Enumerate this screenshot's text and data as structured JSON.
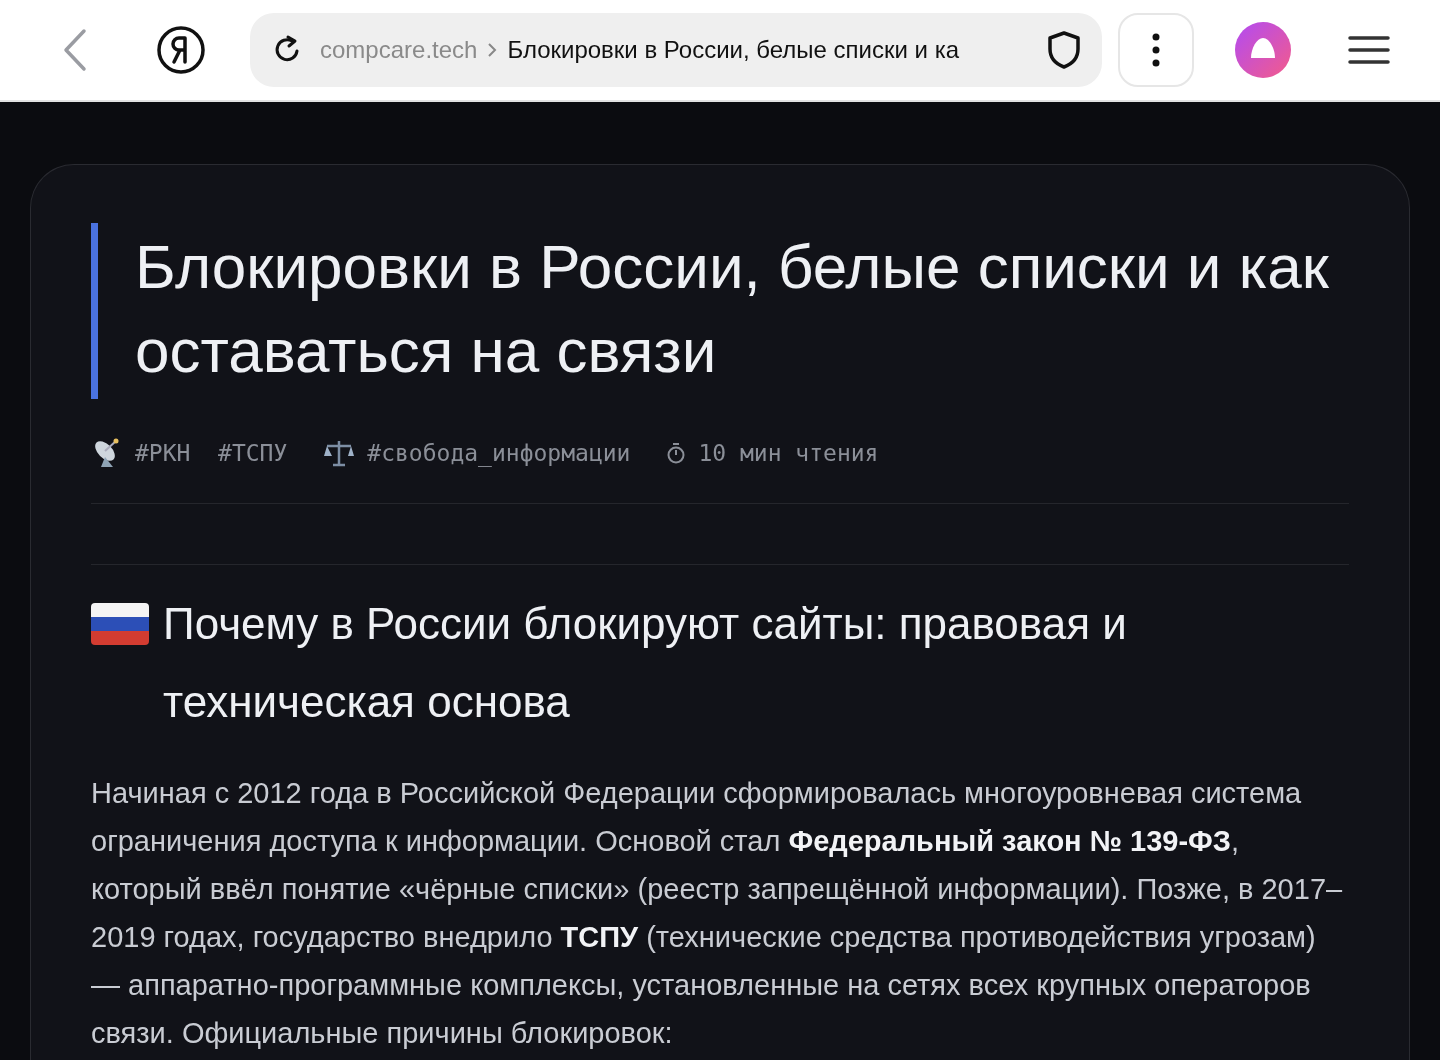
{
  "browser": {
    "domain": "compcare.tech",
    "page_title": "Блокировки в России, белые списки и ка"
  },
  "article": {
    "title": "Блокировки в России, белые списки и как оставаться на связи",
    "meta": [
      {
        "kind": "satellite",
        "text": "#РКН  #ТСПУ"
      },
      {
        "kind": "scales",
        "text": "#свобода_информации"
      },
      {
        "kind": "timer",
        "text": "10 мин чтения"
      }
    ],
    "section": {
      "heading": "Почему в России блокируют сайты: правовая и техническая основа",
      "paragraph": "Начиная с 2012 года в Российской Федерации сформировалась многоуровневая система ограничения доступа к информации. Основой стал **Федеральный закон № 139-ФЗ**, который ввёл понятие «чёрные списки» (реестр запрещённой информации). Позже, в 2017–2019 годах, государство внедрило **ТСПУ** (технические средства противодействия угрозам) — аппаратно-программные комплексы, установленные на сетях всех крупных операторов связи. Официальные причины блокировок:"
    }
  }
}
